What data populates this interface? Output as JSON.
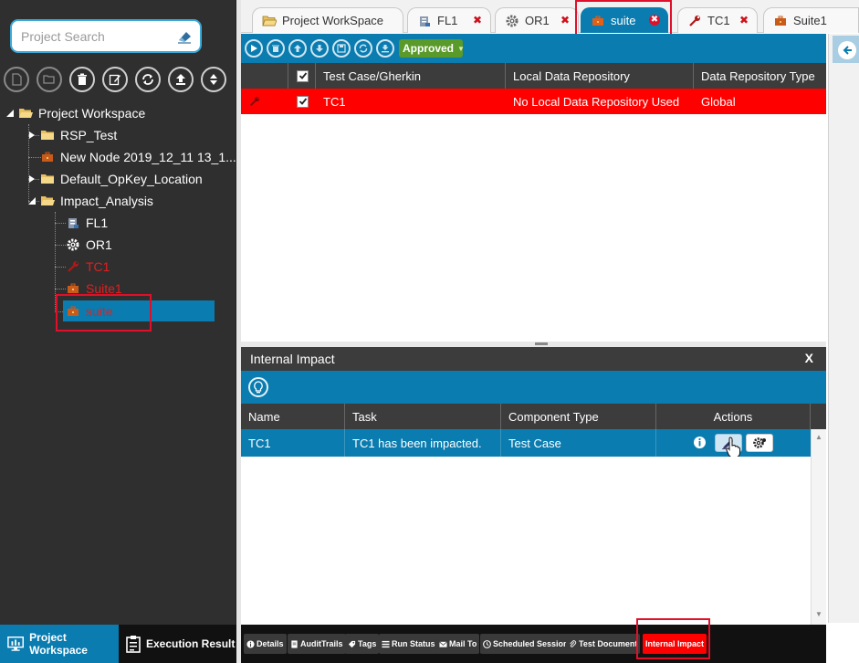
{
  "search": {
    "placeholder": "Project Search"
  },
  "tree": {
    "root": "Project Workspace",
    "items": [
      {
        "label": "RSP_Test"
      },
      {
        "label": "New Node 2019_12_11 13_1..."
      },
      {
        "label": "Default_OpKey_Location"
      },
      {
        "label": "Impact_Analysis"
      },
      {
        "label": "FL1"
      },
      {
        "label": "OR1"
      },
      {
        "label": "TC1"
      },
      {
        "label": "Suite1"
      },
      {
        "label": "suite"
      }
    ]
  },
  "left_bottom": {
    "project_workspace": "Project Workspace",
    "execution_result": "Execution Result"
  },
  "tabs": [
    {
      "label": "Project WorkSpace"
    },
    {
      "label": "FL1",
      "close": "✖"
    },
    {
      "label": "OR1",
      "close": "✖"
    },
    {
      "label": "suite",
      "close": "✖"
    },
    {
      "label": "TC1",
      "close": "✖"
    },
    {
      "label": "Suite1",
      "close": "✖"
    }
  ],
  "toolbar": {
    "approved": "Approved",
    "caret": "▼"
  },
  "grid": {
    "headers": [
      "Test Case/Gherkin",
      "Local Data Repository",
      "Data Repository Type"
    ],
    "row": {
      "test_case": "TC1",
      "local_repo": "No Local Data Repository Used",
      "repo_type": "Global"
    }
  },
  "impact": {
    "title": "Internal Impact",
    "close": "X",
    "headers": [
      "Name",
      "Task",
      "Component Type",
      "Actions"
    ],
    "row": {
      "name": "TC1",
      "task": "TC1 has been impacted.",
      "component_type": "Test Case"
    }
  },
  "bottom_tabs": [
    {
      "label": "Details"
    },
    {
      "label": "AuditTrails"
    },
    {
      "label": "Tags"
    },
    {
      "label": "Run Status"
    },
    {
      "label": "Mail To"
    },
    {
      "label": "Scheduled Session"
    },
    {
      "label": "Test Document"
    },
    {
      "label": "Internal Impact"
    }
  ],
  "colors": {
    "accent": "#0a7cb0",
    "header_dark": "#3c3c3c",
    "selected_red": "#ff0000",
    "highlight_box": "#e0102a",
    "approved_green": "#5a9a2a"
  }
}
